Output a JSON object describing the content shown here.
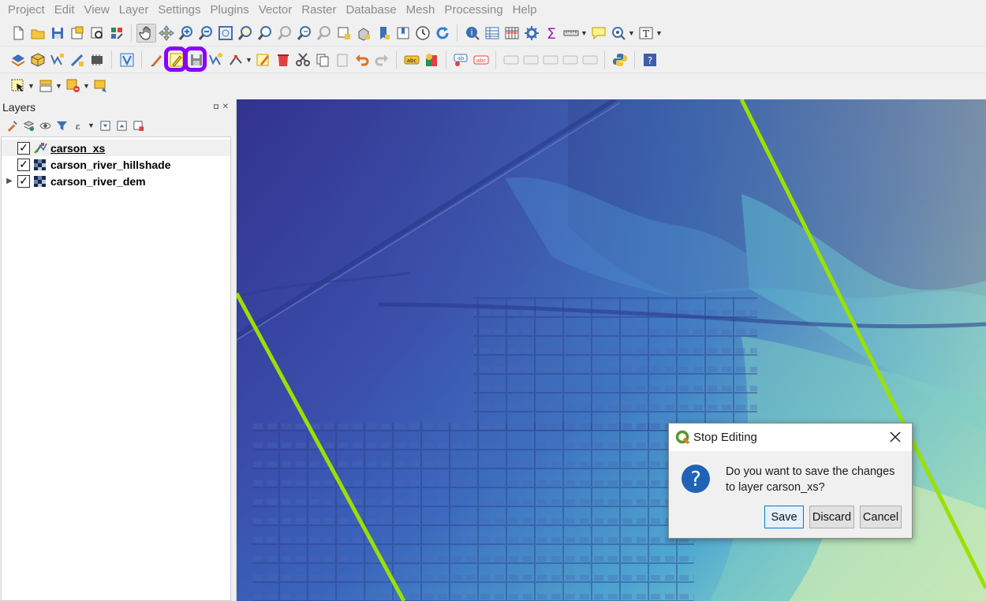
{
  "menubar": {
    "items": [
      "Project",
      "Edit",
      "View",
      "Layer",
      "Settings",
      "Plugins",
      "Vector",
      "Raster",
      "Database",
      "Mesh",
      "Processing",
      "Help"
    ]
  },
  "toolbars": {
    "highlight_color": "#8b00ff",
    "highlighted_buttons": [
      "toggle-editing-icon",
      "save-layer-edits-icon"
    ]
  },
  "layers_panel": {
    "title": "Layers",
    "header_buttons": "◘ ✕",
    "layers": [
      {
        "name": "carson_xs",
        "checked": true,
        "type": "vector-line",
        "selected": true,
        "check_glyph": "✓"
      },
      {
        "name": "carson_river_hillshade",
        "checked": true,
        "type": "raster",
        "check_glyph": "✓"
      },
      {
        "name": "carson_river_dem",
        "checked": true,
        "type": "raster",
        "expander": "▶",
        "check_glyph": "✓"
      }
    ]
  },
  "map": {
    "cross_section_color": "#9ae000",
    "dem_colors": [
      "#33328f",
      "#3a58b8",
      "#3fa0d2",
      "#7fd3c8",
      "#dff0b2"
    ]
  },
  "dialog": {
    "title": "Stop Editing",
    "message": "Do you want to save the changes to layer carson_xs?",
    "buttons": {
      "save": "Save",
      "discard": "Discard",
      "cancel": "Cancel"
    },
    "icon": "question-icon",
    "default_button_color": "#0078d7"
  }
}
